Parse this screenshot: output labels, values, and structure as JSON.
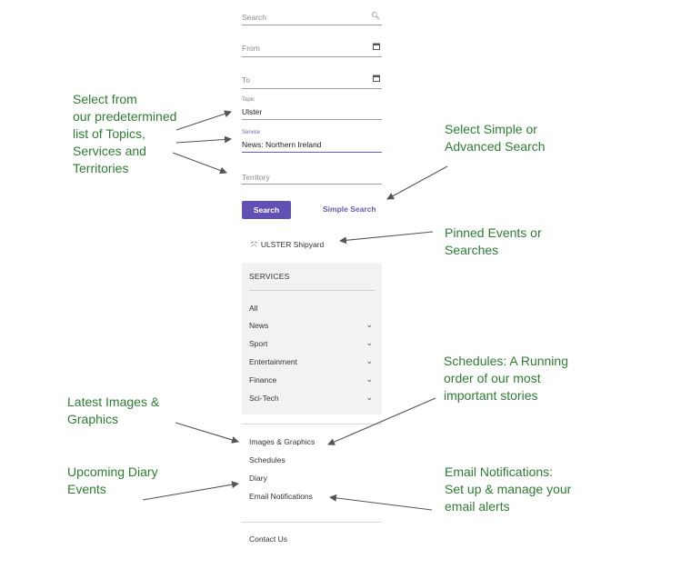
{
  "form": {
    "search_placeholder": "Search",
    "from_placeholder": "From",
    "to_placeholder": "To",
    "topic_label": "Topic",
    "topic_value": "Ulster",
    "service_label": "Service",
    "service_value": "News: Northern Ireland",
    "territory_placeholder": "Territory",
    "search_button": "Search",
    "simple_search_link": "Simple Search"
  },
  "icons": {
    "search": "search-icon",
    "calendar": "calendar-icon",
    "pin": "pin-icon",
    "chevron": "chevron-down-icon"
  },
  "pinned": {
    "label": "ULSTER Shipyard"
  },
  "services": {
    "heading": "SERVICES",
    "items": [
      {
        "label": "All",
        "expandable": false
      },
      {
        "label": "News",
        "expandable": true
      },
      {
        "label": "Sport",
        "expandable": true
      },
      {
        "label": "Entertainment",
        "expandable": true
      },
      {
        "label": "Finance",
        "expandable": true
      },
      {
        "label": "Sci-Tech",
        "expandable": true
      }
    ]
  },
  "nav": {
    "images": "Images & Graphics",
    "schedules": "Schedules",
    "diary": "Diary",
    "email": "Email Notifications",
    "contact": "Contact Us"
  },
  "annotations": {
    "select_from": [
      "Select from",
      "our predetermined",
      "list of Topics,",
      "Services and",
      "Territories"
    ],
    "simple_advanced": [
      "Select Simple or",
      "Advanced Search"
    ],
    "pinned": [
      "Pinned Events or",
      "Searches"
    ],
    "schedules": [
      "Schedules: A Running",
      "order of our most",
      "important stories"
    ],
    "latest_images": [
      "Latest Images &",
      "Graphics"
    ],
    "diary": [
      "Upcoming Diary",
      "Events"
    ],
    "email": [
      "Email Notifications:",
      "Set up & manage your",
      "email alerts"
    ]
  },
  "colors": {
    "accent": "#6250b4",
    "annotation_text": "#2e7d32",
    "panel": "#f2f2f2"
  }
}
